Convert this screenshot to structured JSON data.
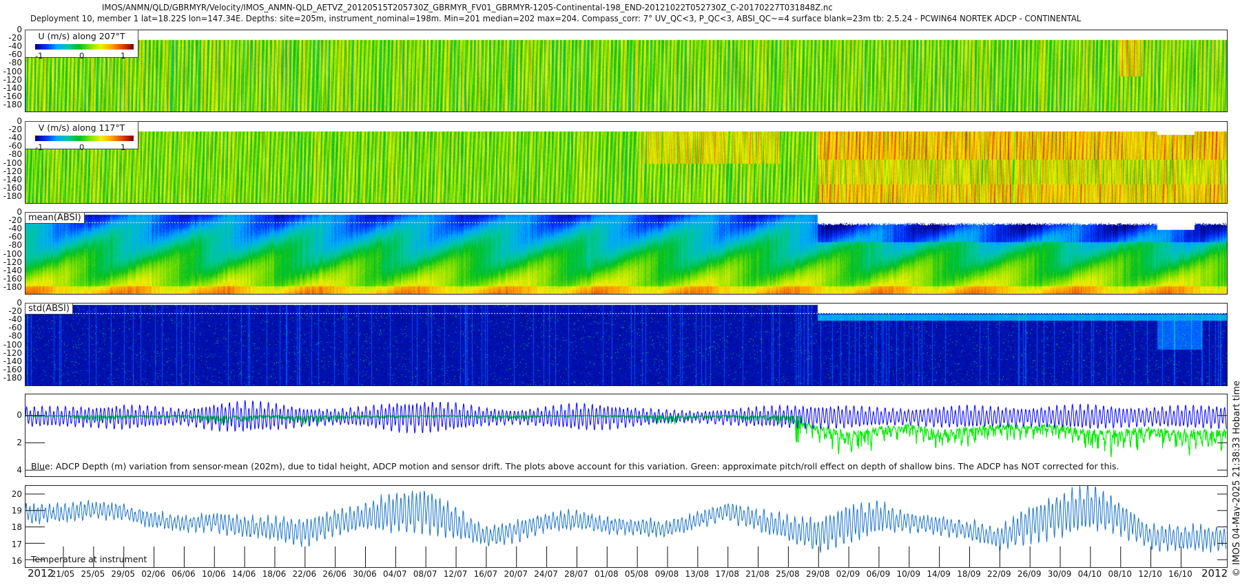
{
  "title": {
    "line1": "IMOS/ANMN/QLD/GBRMYR/Velocity/IMOS_ANMN-QLD_AETVZ_20120515T205730Z_GBRMYR_FV01_GBRMYR-1205-Continental-198_END-20121022T052730Z_C-20170227T031848Z.nc",
    "line2": "Deployment 10, member 1 lat=18.22S lon=147.34E. Depths: site=205m, instrument_nominal=198m. Min=201 median=202 max=204. Compass_corr: 7° UV_QC<3, P_QC<3, ABSI_QC~=4 surface blank=23m tb: 2.5.24 - PCWIN64 NORTEK ADCP - CONTINENTAL"
  },
  "credit": "© IMOS 04-May-2025 21:38:33 Hobart time",
  "colormap": [
    "#00007f",
    "#0030ff",
    "#00a8ff",
    "#00c8a0",
    "#00c020",
    "#80e000",
    "#f0f000",
    "#ffa000",
    "#e04000",
    "#800000"
  ],
  "chart_data": [
    {
      "type": "heatmap",
      "panel": "u",
      "legend": "U (m/s) along 207°T",
      "colorbar_ticks": [
        "-1",
        "0",
        "1"
      ],
      "clim": [
        -1.3,
        1.3
      ],
      "y_ticks": [
        "0",
        "-20",
        "-40",
        "-60",
        "-80",
        "-100",
        "-120",
        "-140",
        "-160",
        "-180"
      ],
      "ylim": [
        -200,
        0
      ],
      "surface_blank_m": 23,
      "description_values": {
        "typical": 0.1,
        "stripe_range": [
          -0.3,
          0.6
        ]
      }
    },
    {
      "type": "heatmap",
      "panel": "v",
      "legend": "V (m/s) along 117°T",
      "colorbar_ticks": [
        "-1",
        "0",
        "1"
      ],
      "clim": [
        -1.3,
        1.3
      ],
      "y_ticks": [
        "0",
        "-20",
        "-40",
        "-60",
        "-80",
        "-100",
        "-120",
        "-140",
        "-160",
        "-180"
      ],
      "ylim": [
        -200,
        0
      ],
      "description_values": {
        "typical": 0.15,
        "after_29_08": 0.7
      }
    },
    {
      "type": "heatmap",
      "panel": "mean-absi",
      "legend": "mean(ABSI)",
      "y_ticks": [
        "0",
        "-20",
        "-40",
        "-60",
        "-80",
        "-100",
        "-120",
        "-140",
        "-160",
        "-180"
      ],
      "ylim": [
        -200,
        0
      ]
    },
    {
      "type": "heatmap",
      "panel": "std-absi",
      "legend": "std(ABSI)",
      "y_ticks": [
        "0",
        "-20",
        "-40",
        "-60",
        "-80",
        "-100",
        "-120",
        "-140",
        "-160",
        "-180"
      ],
      "ylim": [
        -200,
        0
      ]
    },
    {
      "type": "line",
      "panel": "depth",
      "caption": "Blue: ADCP Depth (m) variation from sensor-mean (202m), due to tidal height, ADCP motion and sensor drift. The plots above account for this variation. Green: approximate pitch/roll effect on depth of shallow bins. The ADCP has NOT corrected for this.",
      "y_ticks": [
        "0",
        "2",
        "4"
      ],
      "ylim": [
        4.45,
        -1.55
      ],
      "reversed": true,
      "x": "x_ticks",
      "series": [
        {
          "color": "#0000ff",
          "tidal_amplitude": [
            0.9,
            0.9,
            1.1,
            0.9,
            0.7,
            1.2,
            1.4,
            1.2,
            0.8,
            0.7,
            0.9,
            1.3,
            1.4,
            1.2,
            0.8,
            0.6,
            0.9,
            1.2,
            1.1,
            0.8,
            0.6,
            0.5,
            0.7,
            0.9,
            1.0,
            1.0,
            1.0,
            0.8,
            0.7,
            0.9,
            1.0,
            0.9,
            0.8,
            1.0,
            1.1,
            0.9,
            0.8,
            1.0
          ]
        },
        {
          "color": "#00ee00",
          "offset": [
            0.05,
            0.2,
            0.1,
            0.1,
            0.05,
            0.3,
            0.2,
            0.1,
            0.3,
            0.15,
            0.1,
            0.1,
            0.05,
            0.05,
            0.1,
            0.15,
            0.05,
            0.05,
            0.05,
            0.1,
            0.3,
            0.1,
            0.1,
            0.2,
            0.3,
            1.8,
            2.8,
            2.0,
            1.5,
            2.5,
            2.0,
            1.5,
            1.8,
            1.5,
            2.5,
            2.5,
            2.0,
            2.5
          ]
        }
      ]
    },
    {
      "type": "line",
      "panel": "temperature",
      "caption": "Temperature at instrument",
      "y_ticks": [
        "20",
        "19",
        "18",
        "17",
        "16"
      ],
      "ylim": [
        15.55,
        20.5
      ],
      "x": "x_ticks",
      "series": [
        {
          "color": "#1a73c8",
          "mean": [
            18.8,
            19.1,
            18.9,
            18.4,
            18.2,
            18.3,
            18.0,
            17.9,
            17.7,
            18.3,
            18.6,
            18.9,
            19.0,
            18.2,
            17.4,
            17.8,
            18.3,
            18.4,
            18.1,
            18.0,
            17.9,
            18.4,
            19.0,
            18.4,
            17.9,
            17.5,
            18.2,
            18.6,
            18.3,
            18.1,
            17.8,
            17.3,
            18.2,
            18.7,
            19.2,
            18.6,
            17.4,
            17.3
          ],
          "amplitude": [
            0.6,
            0.6,
            0.5,
            0.5,
            0.5,
            0.6,
            0.7,
            0.7,
            0.9,
            0.8,
            0.9,
            1.3,
            1.5,
            1.0,
            0.6,
            0.7,
            0.6,
            0.6,
            0.5,
            0.5,
            0.5,
            0.5,
            0.6,
            0.7,
            0.8,
            1.1,
            1.3,
            1.0,
            0.6,
            0.6,
            0.6,
            0.7,
            1.2,
            1.4,
            1.5,
            1.1,
            0.8,
            0.8
          ]
        }
      ]
    }
  ],
  "x_axis": {
    "year_left": "2012",
    "year_right": "2012",
    "x_ticks": [
      "21/05",
      "25/05",
      "29/05",
      "02/06",
      "06/06",
      "10/06",
      "14/06",
      "18/06",
      "22/06",
      "26/06",
      "30/06",
      "04/07",
      "08/07",
      "12/07",
      "16/07",
      "20/07",
      "24/07",
      "28/07",
      "01/08",
      "05/08",
      "09/08",
      "13/08",
      "17/08",
      "21/08",
      "25/08",
      "29/08",
      "02/09",
      "06/09",
      "10/09",
      "14/09",
      "18/09",
      "22/09",
      "26/09",
      "30/09",
      "04/10",
      "08/10",
      "12/10",
      "16/10"
    ]
  }
}
